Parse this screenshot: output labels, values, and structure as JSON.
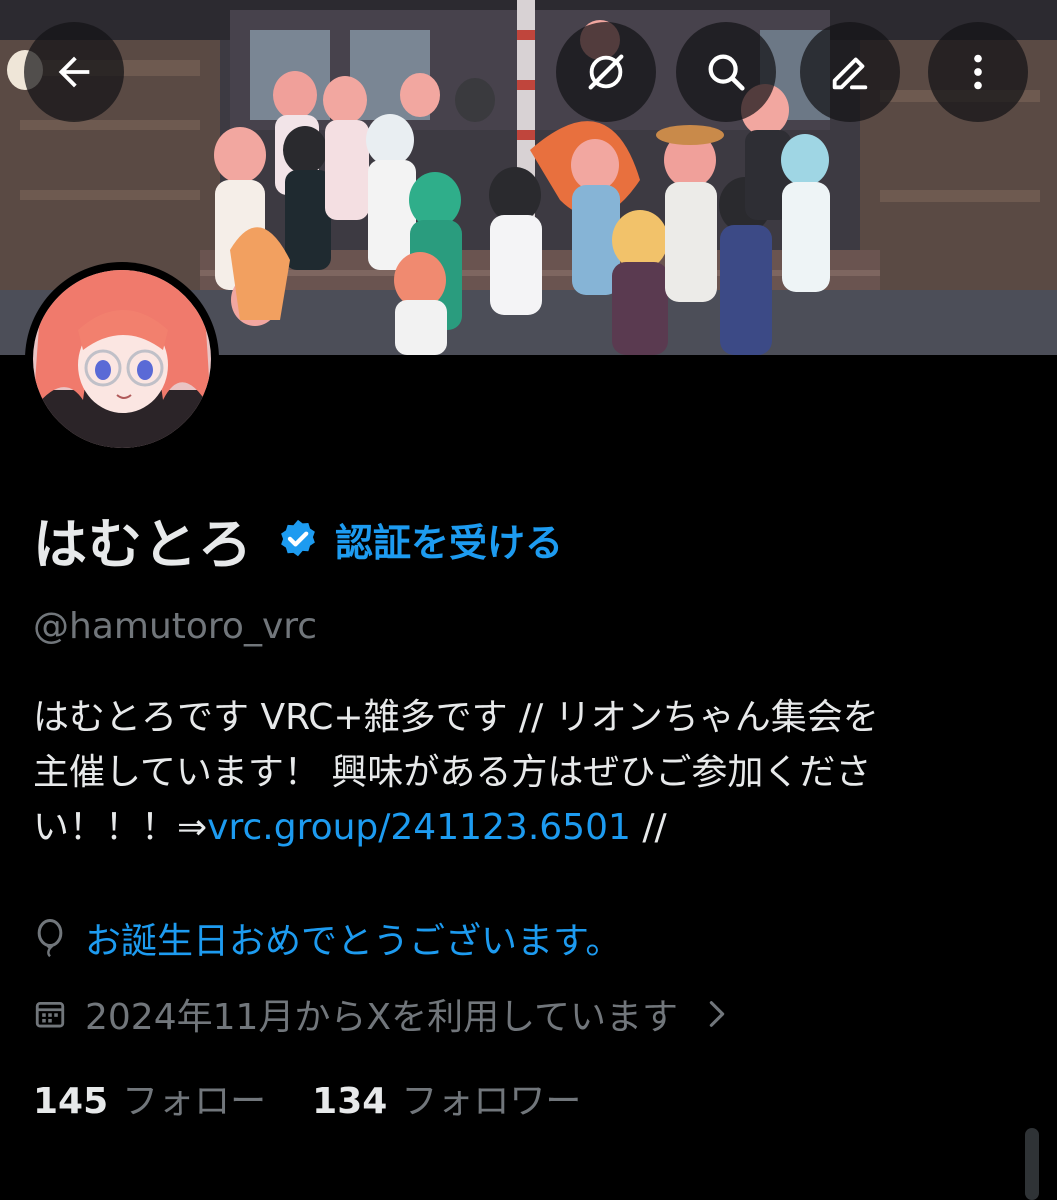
{
  "header": {
    "back_label": "Back",
    "grok_label": "Grok",
    "search_label": "Search",
    "compose_label": "Compose",
    "more_label": "More options"
  },
  "profile": {
    "display_name": "はむとろ",
    "verify_cta": "認証を受ける",
    "handle": "@hamutoro_vrc",
    "bio_lines": [
      "はむとろです VRC+雑多です // リオンちゃん集会を",
      "主催しています！ 興味がある方はぜひご参加くださ"
    ],
    "bio_line3_prefix": "い！！！⇒",
    "bio_link": "vrc.group/241123.6501",
    "bio_line3_suffix": " //",
    "birthday": "お誕生日おめでとうございます。",
    "joined": "2024年11月からXを利用しています",
    "following_count": "145",
    "following_label": "フォロー",
    "followers_count": "134",
    "followers_label": "フォロワー"
  },
  "icons": {
    "back": "arrow-left-icon",
    "grok": "grok-icon",
    "search": "search-icon",
    "compose": "compose-icon",
    "more": "more-vertical-icon",
    "verified": "verified-badge-icon",
    "birthday": "balloon-icon",
    "joined": "calendar-icon",
    "chevron": "chevron-right-icon"
  },
  "colors": {
    "accent": "#1d9bf0",
    "secondary_text": "#71767b",
    "primary_text": "#e7e9ea",
    "background": "#000000"
  }
}
